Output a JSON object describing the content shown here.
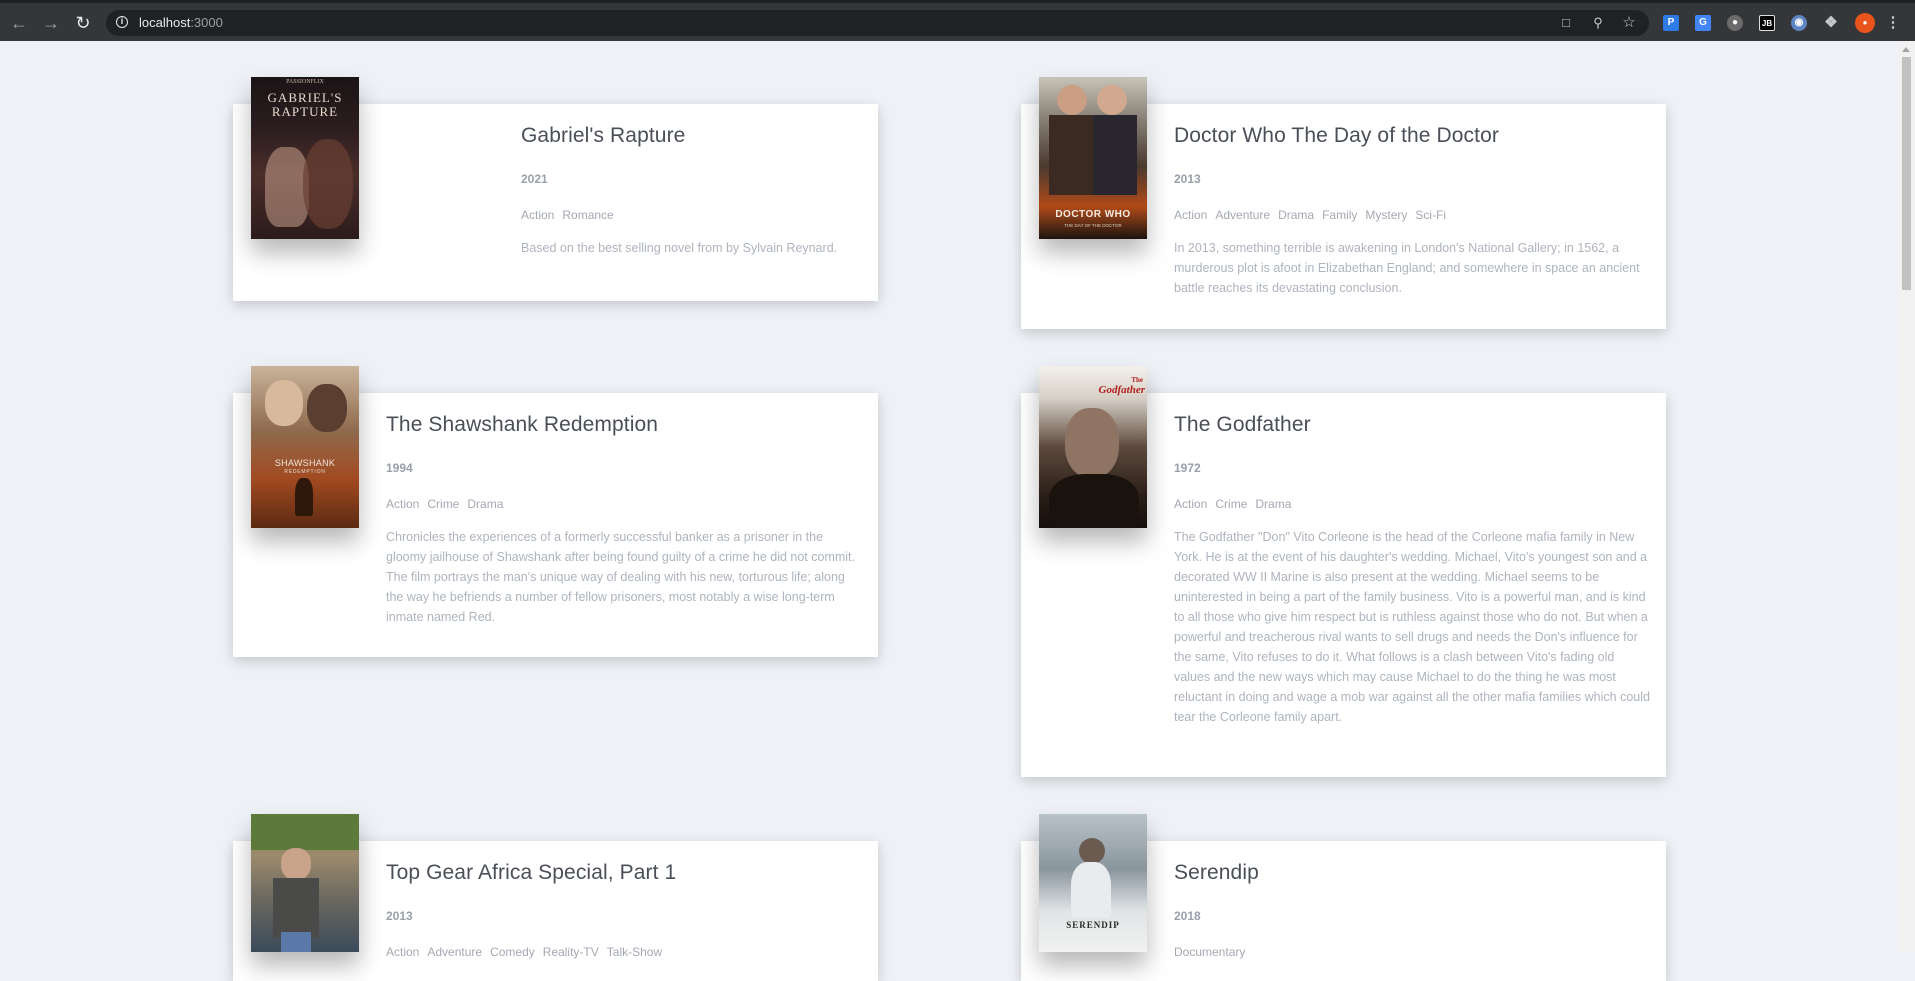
{
  "browser": {
    "url_host": "localhost",
    "url_port": ":3000"
  },
  "movies": [
    {
      "title": "Gabriel's Rapture",
      "year": "2021",
      "genres": [
        "Action",
        "Romance"
      ],
      "summary": "Based on the best selling novel from by Sylvain Reynard.",
      "poster_text": "GABRIEL'S RAPTURE",
      "poster_top_text": "PASSIONFLIX"
    },
    {
      "title": "Doctor Who The Day of the Doctor",
      "year": "2013",
      "genres": [
        "Action",
        "Adventure",
        "Drama",
        "Family",
        "Mystery",
        "Sci-Fi"
      ],
      "summary": "In 2013, something terrible is awakening in London's National Gallery; in 1562, a murderous plot is afoot in Elizabethan England; and somewhere in space an ancient battle reaches its devastating conclusion.",
      "poster_text": "DOCTOR WHO",
      "poster_sub_text": "THE DAY OF THE DOCTOR"
    },
    {
      "title": "The Shawshank Redemption",
      "year": "1994",
      "genres": [
        "Action",
        "Crime",
        "Drama"
      ],
      "summary": "Chronicles the experiences of a formerly successful banker as a prisoner in the gloomy jailhouse of Shawshank after being found guilty of a crime he did not commit. The film portrays the man's unique way of dealing with his new, torturous life; along the way he befriends a number of fellow prisoners, most notably a wise long-term inmate named Red.",
      "poster_text": "SHAWSHANK",
      "poster_sub_text": "REDEMPTION"
    },
    {
      "title": "The Godfather",
      "year": "1972",
      "genres": [
        "Action",
        "Crime",
        "Drama"
      ],
      "summary": "The Godfather \"Don\" Vito Corleone is the head of the Corleone mafia family in New York. He is at the event of his daughter's wedding. Michael, Vito's youngest son and a decorated WW II Marine is also present at the wedding. Michael seems to be uninterested in being a part of the family business. Vito is a powerful man, and is kind to all those who give him respect but is ruthless against those who do not. But when a powerful and treacherous rival wants to sell drugs and needs the Don's influence for the same, Vito refuses to do it. What follows is a clash between Vito's fading old values and the new ways which may cause Michael to do the thing he was most reluctant in doing and wage a mob war against all the other mafia families which could tear the Corleone family apart.",
      "poster_text_1": "The",
      "poster_text_2": "Godfather"
    },
    {
      "title": "Top Gear Africa Special, Part 1",
      "year": "2013",
      "genres": [
        "Action",
        "Adventure",
        "Comedy",
        "Reality-TV",
        "Talk-Show"
      ]
    },
    {
      "title": "Serendip",
      "year": "2018",
      "genres": [
        "Documentary"
      ],
      "poster_text": "SERENDIP"
    }
  ]
}
